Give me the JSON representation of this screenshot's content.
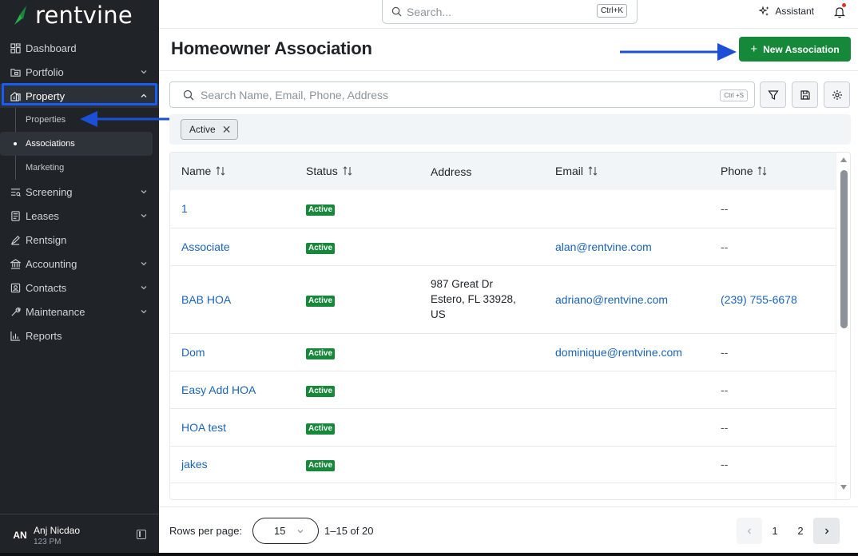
{
  "app": {
    "logo_text": "rentvine",
    "brand_green": "#16883a"
  },
  "sidebar": {
    "items": [
      {
        "label": "Dashboard",
        "icon": "dashboard-icon",
        "chevron": false
      },
      {
        "label": "Portfolio",
        "icon": "portfolio-icon",
        "chevron": "down"
      },
      {
        "label": "Property",
        "icon": "property-icon",
        "chevron": "up"
      },
      {
        "label": "Screening",
        "icon": "screening-icon",
        "chevron": "down"
      },
      {
        "label": "Leases",
        "icon": "leases-icon",
        "chevron": "down"
      },
      {
        "label": "Rentsign",
        "icon": "rentsign-icon",
        "chevron": false
      },
      {
        "label": "Accounting",
        "icon": "accounting-icon",
        "chevron": "down"
      },
      {
        "label": "Contacts",
        "icon": "contacts-icon",
        "chevron": "down"
      },
      {
        "label": "Maintenance",
        "icon": "maintenance-icon",
        "chevron": "down"
      },
      {
        "label": "Reports",
        "icon": "reports-icon",
        "chevron": false
      }
    ],
    "property_sub": [
      "Properties",
      "Associations",
      "Marketing"
    ],
    "selected_sub": "Associations"
  },
  "user": {
    "initials": "AN",
    "name": "Anj Nicdao",
    "time": "123 PM"
  },
  "topbar": {
    "search_placeholder": "Search...",
    "search_shortcut": "Ctrl+K",
    "assistant_label": "Assistant"
  },
  "page": {
    "title": "Homeowner Association",
    "new_button": "New Association"
  },
  "filter": {
    "placeholder": "Search Name, Email, Phone, Address",
    "shortcut": "Ctrl +S",
    "chip": "Active"
  },
  "table": {
    "columns": [
      "Name",
      "Status",
      "Address",
      "Email",
      "Phone"
    ],
    "rows": [
      {
        "name": "1",
        "status": "Active",
        "address": "",
        "email": "",
        "phone": "--"
      },
      {
        "name": "Associate",
        "status": "Active",
        "address": "",
        "email": "alan@rentvine.com",
        "phone": "--"
      },
      {
        "name": "BAB HOA",
        "status": "Active",
        "address": [
          "987 Great Dr",
          "Estero, FL 33928,",
          "US"
        ],
        "email": "adriano@rentvine.com",
        "phone": "(239) 755-6678"
      },
      {
        "name": "Dom",
        "status": "Active",
        "address": "",
        "email": "dominique@rentvine.com",
        "phone": "--"
      },
      {
        "name": "Easy Add HOA",
        "status": "Active",
        "address": "",
        "email": "",
        "phone": "--"
      },
      {
        "name": "HOA test",
        "status": "Active",
        "address": "",
        "email": "",
        "phone": "--"
      },
      {
        "name": "jakes",
        "status": "Active",
        "address": "",
        "email": "",
        "phone": "--"
      }
    ]
  },
  "pagination": {
    "rows_label": "Rows per page:",
    "rows_value": "15",
    "range": "1–15 of 20",
    "pages": [
      "1",
      "2"
    ],
    "current_page": "1"
  }
}
